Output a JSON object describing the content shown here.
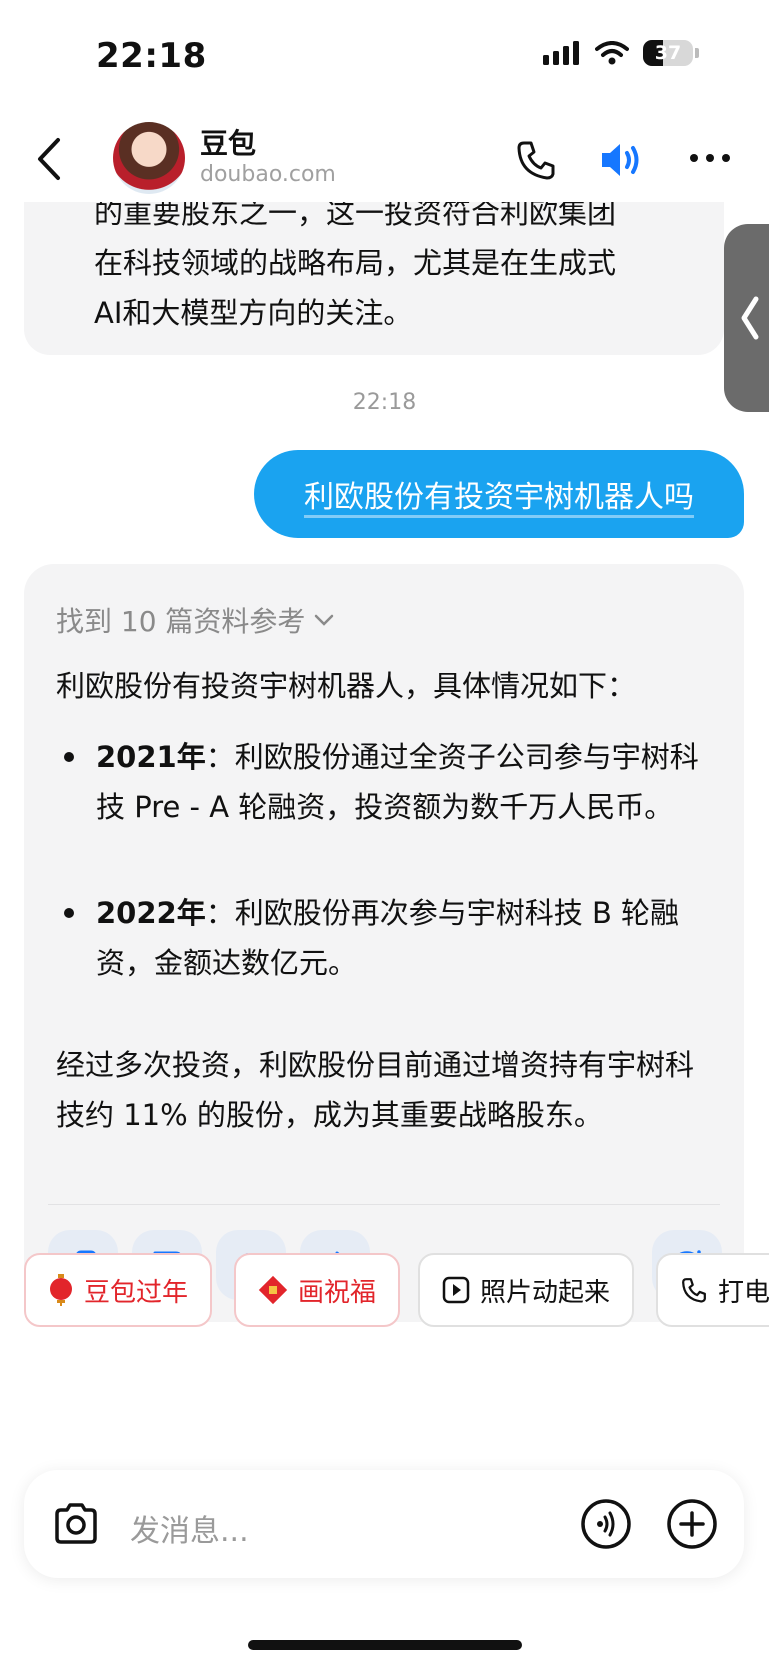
{
  "status_bar": {
    "time": "22:18",
    "battery": "37"
  },
  "header": {
    "bot_name": "豆包",
    "bot_domain": "doubao.com"
  },
  "previous_message": {
    "lines": [
      "的重要股东之一，这一投资符合利欧集团",
      "在科技领域的战略布局，尤其是在生成式",
      "AI和大模型方向的关注。"
    ]
  },
  "timestamp": "22:18",
  "user_message": "利欧股份有投资宇树机器人吗",
  "answer": {
    "sources_label": "找到 10 篇资料参考",
    "intro": "利欧股份有投资宇树机器人，具体情况如下：",
    "bullets": [
      {
        "year": "2021年",
        "text": "：利欧股份通过全资子公司参与宇树科技 Pre - A 轮融资，投资额为数千万人民币。"
      },
      {
        "year": "2022年",
        "text": "：利欧股份再次参与宇树科技 B 轮融资，金额达数亿元。"
      }
    ],
    "summary": "经过多次投资，利欧股份目前通过增资持有宇树科技约 11% 的股份，成为其重要战略股东。"
  },
  "chips": [
    {
      "label": "豆包过年",
      "icon": "lantern-icon"
    },
    {
      "label": "画祝福",
      "icon": "fu-icon"
    },
    {
      "label": "照片动起来",
      "icon": "play-icon"
    },
    {
      "label": "打电",
      "icon": "phone-icon"
    }
  ],
  "input": {
    "placeholder": "发消息..."
  },
  "colors": {
    "accent": "#1aa3f0",
    "chip_red": "#e2252b",
    "action_blue": "#1677ff"
  }
}
